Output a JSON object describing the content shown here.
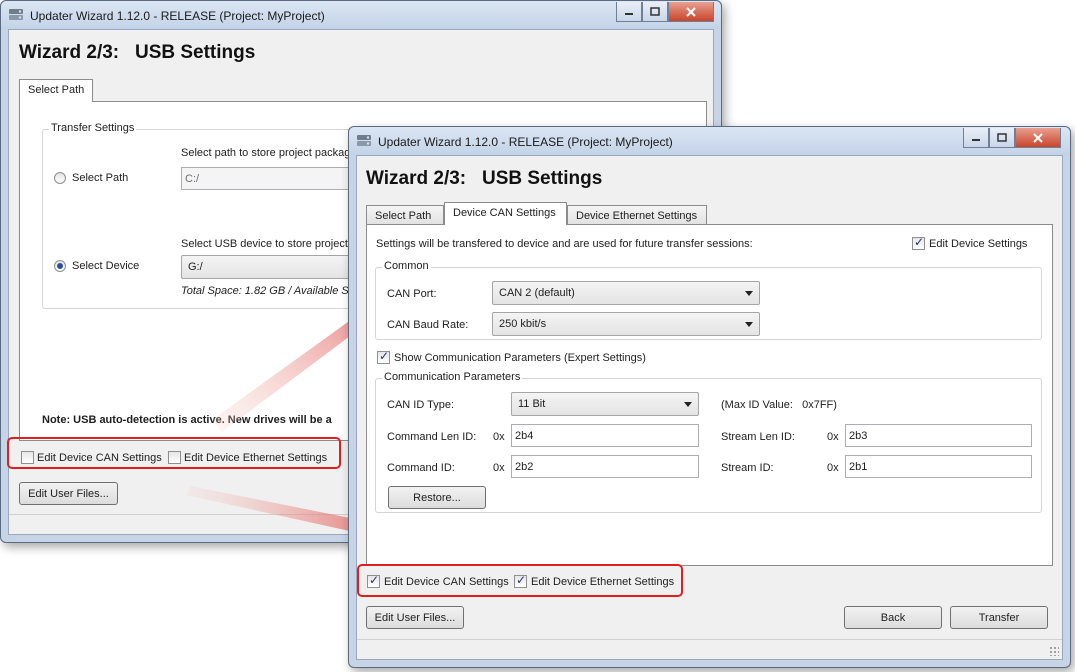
{
  "window_back": {
    "title": "Updater Wizard 1.12.0 - RELEASE (Project: MyProject)",
    "heading": "Wizard 2/3:   USB Settings",
    "tab": "Select Path",
    "group_title": "Transfer Settings",
    "path_prompt": "Select path to store project packag",
    "path_option": "Select Path",
    "path_value": "C:/",
    "device_prompt": "Select USB device to store project p",
    "device_option": "Select Device",
    "device_value": "G:/",
    "space_info": "Total Space: 1.82 GB  /  Available S",
    "note": "Note: USB auto-detection is active. New drives will be a",
    "chk_can": "Edit Device CAN Settings",
    "chk_eth": "Edit Device Ethernet Settings",
    "edit_user_files": "Edit User Files..."
  },
  "window_front": {
    "title": "Updater Wizard 1.12.0 - RELEASE (Project: MyProject)",
    "heading": "Wizard 2/3:   USB Settings",
    "tabs": [
      "Select Path",
      "Device CAN Settings",
      "Device Ethernet Settings"
    ],
    "intro": "Settings will be transfered to device and are used for future transfer sessions:",
    "edit_device_settings": "Edit Device Settings",
    "common_title": "Common",
    "can_port_label": "CAN Port:",
    "can_port_value": "CAN 2 (default)",
    "baud_label": "CAN Baud Rate:",
    "baud_value": "250 kbit/s",
    "show_params": "Show Communication Parameters (Expert Settings)",
    "comm_title": "Communication Parameters",
    "id_type_label": "CAN ID Type:",
    "id_type_value": "11 Bit",
    "max_id": "(Max ID Value:   0x7FF)",
    "cmd_len_label": "Command Len ID:",
    "cmd_len_value": "2b4",
    "stream_len_label": "Stream Len ID:",
    "stream_len_value": "2b3",
    "cmd_id_label": "Command ID:",
    "cmd_id_value": "2b2",
    "stream_id_label": "Stream ID:",
    "stream_id_value": "2b1",
    "hex_prefix": "0x",
    "restore": "Restore...",
    "chk_can": "Edit Device CAN Settings",
    "chk_eth": "Edit Device Ethernet Settings",
    "edit_user_files": "Edit User Files...",
    "back": "Back",
    "transfer": "Transfer"
  },
  "colors": {
    "highlight": "#e02020",
    "frame": "#c6d4e6"
  },
  "icons": {
    "app": "updater-app-icon",
    "minimize": "minimize-icon",
    "maximize": "maximize-icon",
    "close": "close-icon"
  }
}
